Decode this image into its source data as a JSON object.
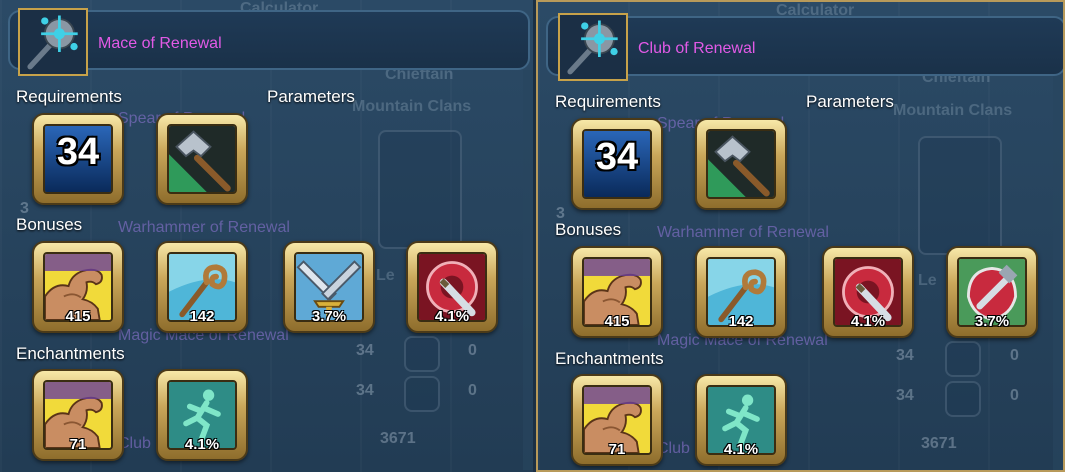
{
  "left": {
    "item_name": "Mace of Renewal",
    "sections": {
      "requirements": "Requirements",
      "parameters": "Parameters",
      "bonuses": "Bonuses",
      "enchantments": "Enchantments"
    },
    "requirement_level": "34",
    "bonuses": [
      {
        "icon": "strength-arm-icon",
        "value": "415"
      },
      {
        "icon": "magic-staff-icon",
        "value": "142"
      },
      {
        "icon": "crossed-swords-icon",
        "value": "3.7%"
      },
      {
        "icon": "red-shield-sword-icon",
        "value": "4.1%"
      }
    ],
    "enchantments": [
      {
        "icon": "strength-arm-icon",
        "value": "71"
      },
      {
        "icon": "running-man-icon",
        "value": "4.1%"
      }
    ],
    "background_text": {
      "calculator": "Calculator",
      "chieftain": "Chieftain",
      "mountain_clans": "Mountain Clans",
      "spear": "Spear of Renewal",
      "warhammer": "Warhammer of Renewal",
      "magic_mace": "Magic Mace of Renewal",
      "club": "Club",
      "le": "Le",
      "n34a": "34",
      "n0a": "0",
      "n34b": "34",
      "n0b": "0",
      "n3671": "3671",
      "n3": "3"
    }
  },
  "right": {
    "item_name": "Club of Renewal",
    "sections": {
      "requirements": "Requirements",
      "parameters": "Parameters",
      "bonuses": "Bonuses",
      "enchantments": "Enchantments"
    },
    "requirement_level": "34",
    "bonuses": [
      {
        "icon": "strength-arm-icon",
        "value": "415"
      },
      {
        "icon": "magic-staff-icon",
        "value": "142"
      },
      {
        "icon": "red-shield-sword-icon",
        "value": "4.1%"
      },
      {
        "icon": "red-shield-hammer-icon",
        "value": "3.7%"
      }
    ],
    "enchantments": [
      {
        "icon": "strength-arm-icon",
        "value": "71"
      },
      {
        "icon": "running-man-icon",
        "value": "4.1%"
      }
    ],
    "background_text": {
      "calculator": "Calculator",
      "chieftain": "Chieftain",
      "mountain_clans": "Mountain Clans",
      "spear": "Spear of Renewal",
      "warhammer": "Warhammer of Renewal",
      "magic_mace": "Magic Mace of Renewal",
      "club": "Club",
      "le": "Le",
      "n34a": "34",
      "n0a": "0",
      "n34b": "34",
      "n0b": "0",
      "n3671": "3671",
      "n3": "3"
    }
  },
  "colors": {
    "item_name": "#e25ae6",
    "frame_gold": "#c7a24a",
    "panel_bg": "#27445e"
  }
}
